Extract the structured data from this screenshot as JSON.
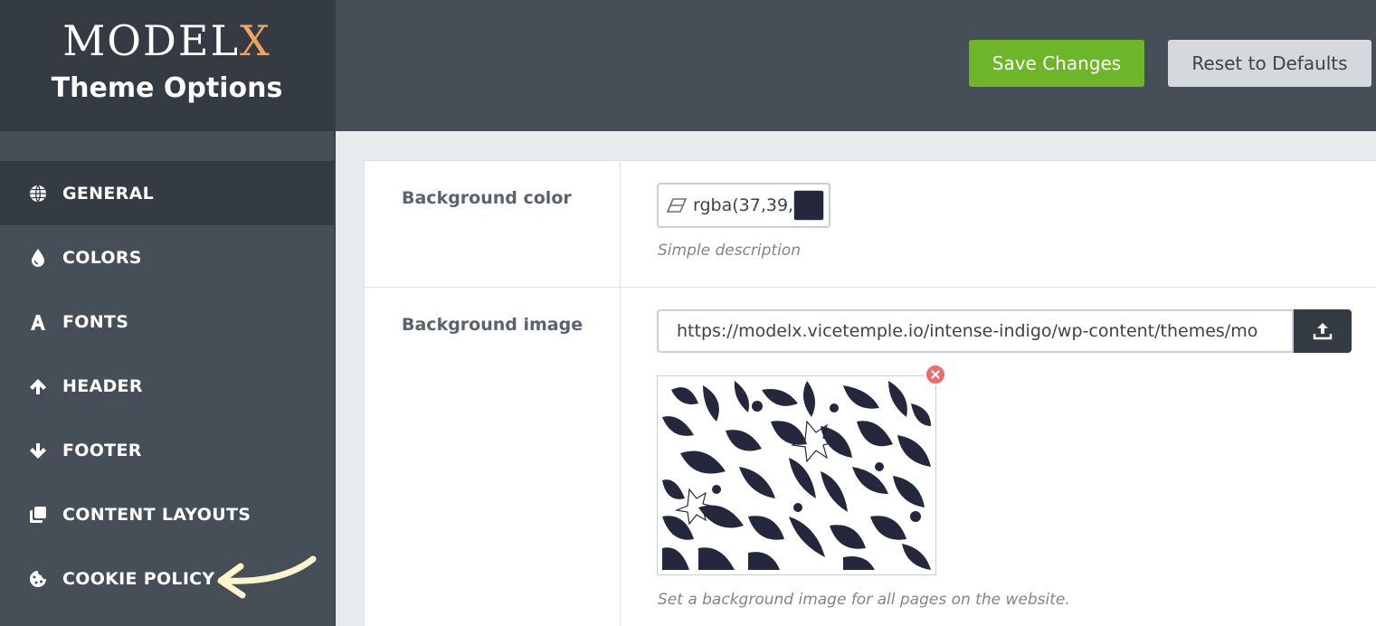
{
  "brand": {
    "logo_main": "MODEL",
    "logo_accent": "X",
    "subtitle": "Theme Options"
  },
  "sidebar": {
    "items": [
      {
        "label": "GENERAL",
        "icon": "globe-icon",
        "active": true
      },
      {
        "label": "COLORS",
        "icon": "droplet-icon",
        "active": false
      },
      {
        "label": "FONTS",
        "icon": "font-icon",
        "active": false
      },
      {
        "label": "HEADER",
        "icon": "arrow-up-icon",
        "active": false
      },
      {
        "label": "FOOTER",
        "icon": "arrow-down-icon",
        "active": false
      },
      {
        "label": "CONTENT LAYOUTS",
        "icon": "clone-icon",
        "active": false
      },
      {
        "label": "COOKIE POLICY",
        "icon": "cookie-icon",
        "active": false
      }
    ]
  },
  "toolbar": {
    "save_label": "Save Changes",
    "reset_label": "Reset to Defaults"
  },
  "options": {
    "background_color": {
      "label": "Background color",
      "value": "rgba(37,39,",
      "swatch": "#25273d",
      "description": "Simple description"
    },
    "background_image": {
      "label": "Background image",
      "url": "https://modelx.vicetemple.io/intense-indigo/wp-content/themes/mo",
      "description": "Set a background image for all pages on the website."
    }
  },
  "colors": {
    "sidebar": "#464e57",
    "sidebar_dark": "#343b43",
    "save": "#6db629",
    "reset": "#d5d9de",
    "accent": "#f0a55e",
    "remove": "#ea6e6e"
  }
}
